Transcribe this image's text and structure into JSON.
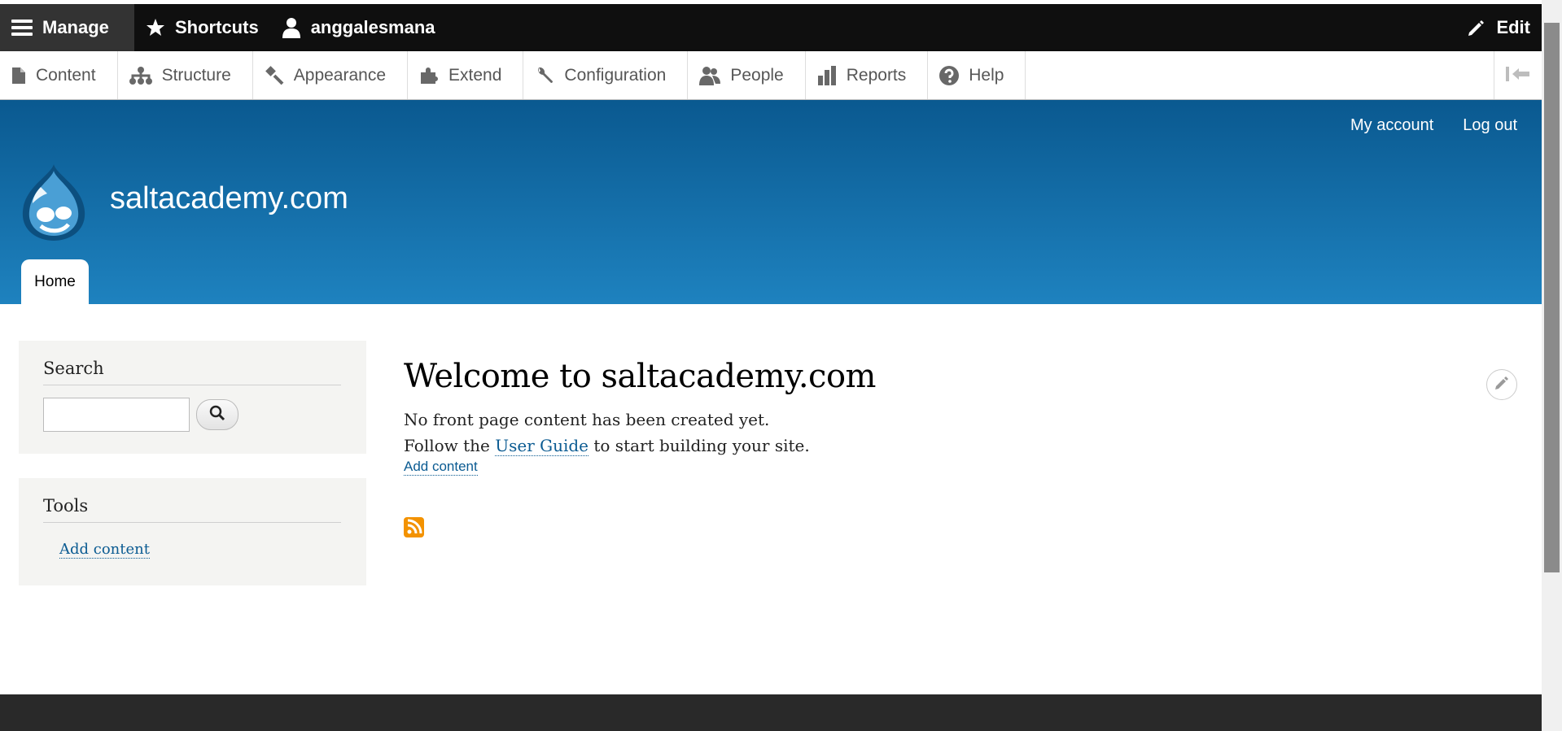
{
  "toolbar": {
    "manage": "Manage",
    "shortcuts": "Shortcuts",
    "user": "anggalesmana",
    "edit": "Edit"
  },
  "tray": {
    "items": [
      "Content",
      "Structure",
      "Appearance",
      "Extend",
      "Configuration",
      "People",
      "Reports",
      "Help"
    ]
  },
  "header": {
    "secondary_menu": [
      "My account",
      "Log out"
    ],
    "site_name": "saltacademy.com",
    "primary_tab": "Home"
  },
  "sidebar": {
    "search_title": "Search",
    "tools_title": "Tools",
    "tools_link": "Add content"
  },
  "main": {
    "title": "Welcome to saltacademy.com",
    "line1": "No front page content has been created yet.",
    "line2_prefix": "Follow the",
    "line2_link": "User Guide",
    "line2_suffix": "to start building your site.",
    "add_content": "Add content"
  },
  "colors": {
    "header_top": "#0a5990",
    "header_bottom": "#1e82bf",
    "link": "#0b5b92",
    "feed": "#f39200"
  }
}
